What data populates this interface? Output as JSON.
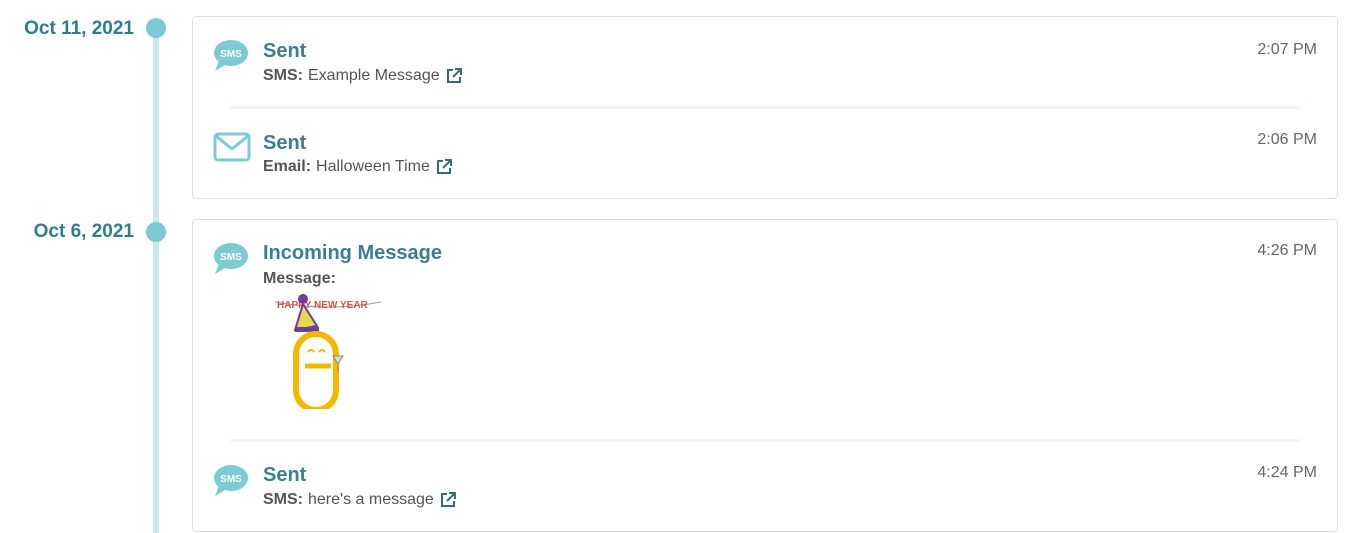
{
  "colors": {
    "accent": "#3b7f8f",
    "rail": "#c5e9ec",
    "dot": "#7ccbd4",
    "icon": "#7ccbd4"
  },
  "days": [
    {
      "date": "Oct 11, 2021",
      "events": [
        {
          "icon": "sms-bubble-icon",
          "title": "Sent",
          "detail_label": "SMS:",
          "detail_value": "Example Message",
          "time": "2:07 PM"
        },
        {
          "icon": "envelope-icon",
          "title": "Sent",
          "detail_label": "Email:",
          "detail_value": "Halloween Time",
          "time": "2:06 PM"
        }
      ]
    },
    {
      "date": "Oct 6, 2021",
      "events": [
        {
          "icon": "sms-bubble-icon",
          "title": "Incoming Message",
          "detail_label": "Message:",
          "gif_text": "HAPPY NEW YEAR",
          "time": "4:26 PM"
        },
        {
          "icon": "sms-bubble-icon",
          "title": "Sent",
          "detail_label": "SMS:",
          "detail_value": "here's a message",
          "time": "4:24 PM"
        }
      ]
    }
  ],
  "sms_icon_text": "SMS"
}
